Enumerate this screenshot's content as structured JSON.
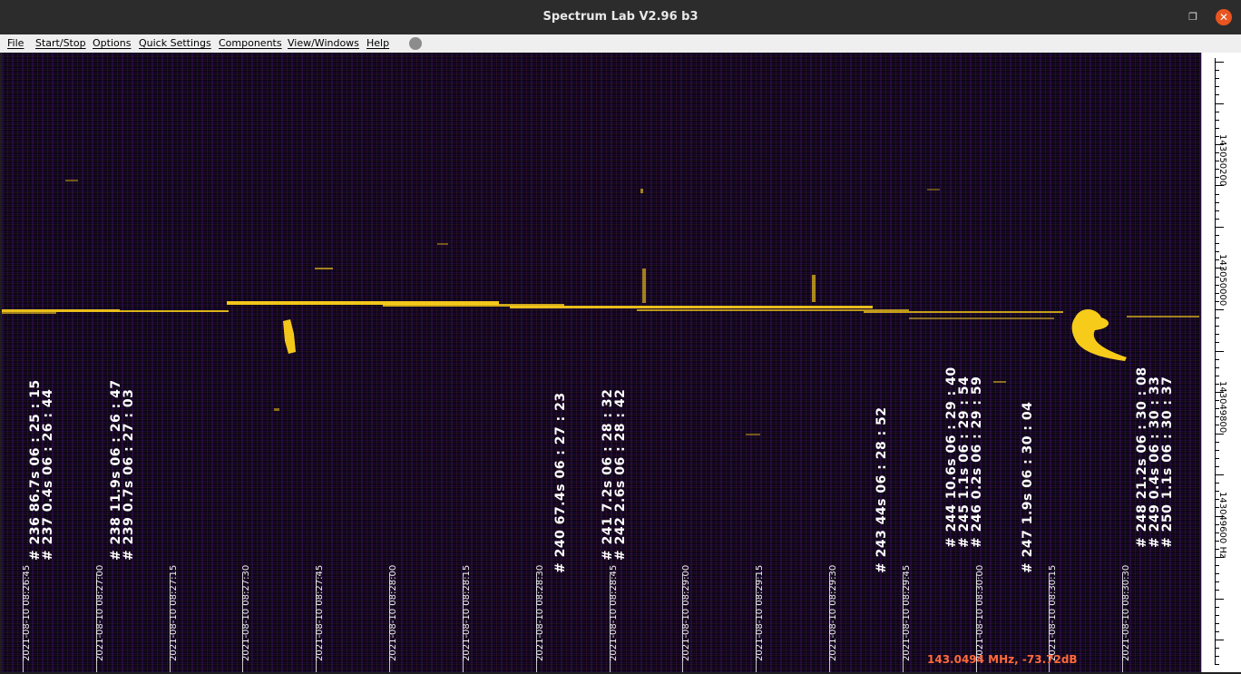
{
  "window": {
    "title": "Spectrum Lab V2.96 b3"
  },
  "menu": [
    "File",
    "Start/Stop",
    "Options",
    "Quick Settings",
    "Components",
    "View/Windows",
    "Help"
  ],
  "meteors": [
    {
      "lines": [
        "# 236   86.7s   06 : 25 : 15",
        "# 237   0.4s   06 : 26 : 44"
      ]
    },
    {
      "lines": [
        "# 238   11.9s   06 : 26 : 47",
        "# 239   0.7s   06 : 27 : 03"
      ]
    },
    {
      "lines": [
        "# 240   67.4s   06 : 27 : 23"
      ]
    },
    {
      "lines": [
        "# 241   7.2s   06 : 28 : 32",
        "# 242   2.6s   06 : 28 : 42"
      ]
    },
    {
      "lines": [
        "# 243   44s   06 : 28 : 52"
      ]
    },
    {
      "lines": [
        "# 244   10.6s   06 : 29 : 40",
        "# 245   1.1s   06 : 29 : 54",
        "# 246   0.2s   06 : 29 : 59"
      ]
    },
    {
      "lines": [
        "# 247   1.9s   06 : 30 : 04"
      ]
    },
    {
      "lines": [
        "# 248   21.2s   06 : 30 : 08",
        "# 249   0.4s   06 : 30 : 33",
        "# 250   1.1s   06 : 30 : 37"
      ]
    }
  ],
  "time_labels": [
    "2021-08-10 08:26:45",
    "2021-08-10 08:27:00",
    "2021-08-10 08:27:15",
    "2021-08-10 08:27:30",
    "2021-08-10 08:27:45",
    "2021-08-10 08:28:00",
    "2021-08-10 08:28:15",
    "2021-08-10 08:28:30",
    "2021-08-10 08:28:45",
    "2021-08-10 08:29:00",
    "2021-08-10 08:29:15",
    "2021-08-10 08:29:30",
    "2021-08-10 08:29:45",
    "2021-08-10 08:30:00",
    "2021-08-10 08:30:15",
    "2021-08-10 08:30:30"
  ],
  "freq_labels": [
    "143050200",
    "143050000",
    "143049800",
    "143049600 Hz"
  ],
  "cursor_readout": "143.0494 MHz, -73.72dB",
  "colors": {
    "signal": "#ffd21a",
    "background": "#0c0516",
    "readout": "#ff6a3c",
    "close_button": "#e95420"
  }
}
